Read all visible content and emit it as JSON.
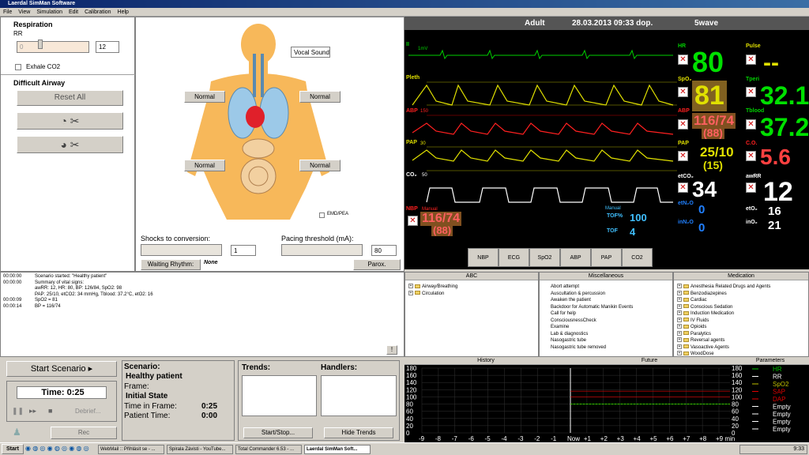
{
  "window": {
    "title": "Laerdal SimMan Software"
  },
  "menu": [
    "File",
    "View",
    "Simulation",
    "Edit",
    "Calibration",
    "Help"
  ],
  "respiration": {
    "title": "Respiration",
    "rr_label": "RR",
    "slider_min": "0",
    "rr_value": "12",
    "exhale_label": "Exhale CO2"
  },
  "airway": {
    "title": "Difficult Airway",
    "reset_label": "Reset All"
  },
  "body": {
    "vocal_label": "Vocal Sound",
    "status_labels": [
      "Normal",
      "Normal",
      "Normal",
      "Normal"
    ],
    "emd_label": "EMD/PEA"
  },
  "defib": {
    "shocks_label": "Shocks to conversion:",
    "shocks_value": "1",
    "pacing_label": "Pacing threshold (mA):",
    "pacing_value": "80",
    "waiting_label": "Waiting Rhythm:",
    "waiting_value": "None",
    "parox_label": "Parox."
  },
  "log": [
    {
      "time": "00:00:00",
      "text": "Scenario started: \"Healthy patient\""
    },
    {
      "time": "00:00:00",
      "text": "Summary of vital signs:"
    },
    {
      "time": "",
      "text": "awRR: 12, HR: 80, BP: 126/84, SpO2: 98"
    },
    {
      "time": "",
      "text": "PAP: 25/10, etCO2: 34 mmHg, Tblood: 37.2°C, etO2: 16"
    },
    {
      "time": "00:00:09",
      "text": "SpO2 = 81"
    },
    {
      "time": "00:00:14",
      "text": "BP = 116/74"
    }
  ],
  "log_button": "!",
  "scenario_ctrl": {
    "start_label": "Start Scenario",
    "time_label": "Time: 0:25",
    "debrief_label": "Debrief...",
    "rec_label": "Rec"
  },
  "scenario_info": {
    "scenario_label": "Scenario:",
    "scenario_name": "Healthy patient",
    "frame_label": "Frame:",
    "frame_name": "Initial State",
    "time_in_frame_label": "Time in Frame:",
    "time_in_frame": "0:25",
    "patient_time_label": "Patient Time:",
    "patient_time": "0:00"
  },
  "trends": {
    "trends_label": "Trends:",
    "handlers_label": "Handlers:",
    "start_stop_label": "Start/Stop...",
    "hide_label": "Hide Trends"
  },
  "monitor": {
    "patient_type": "Adult",
    "datetime": "28.03.2013 09:33 dop.",
    "mode": "5wave",
    "wave_labels": [
      "II",
      "Pleth",
      "ABP",
      "PAP",
      "CO₂"
    ],
    "wave_small": [
      "1mV",
      "",
      "150",
      "30",
      "50"
    ],
    "hr_label": "HR",
    "hr": "80",
    "spo2_label": "SpO₂",
    "spo2": "81",
    "abp_label": "ABP",
    "abp": "116/74",
    "abp_mean": "(88)",
    "pap_label": "PAP",
    "pap": "25/10",
    "pap_mean": "(15)",
    "etco2_label": "etCO₂",
    "etco2": "34",
    "etn2o_label": "etN₂O",
    "etn2o": "0",
    "inn2o_label": "inN₂O",
    "inn2o": "0",
    "pulse_label": "Pulse",
    "pulse": "--",
    "tperi_label": "Tperi",
    "tperi": "32.1",
    "tblood_label": "Tblood",
    "tblood": "37.2",
    "co_label": "C.O.",
    "co": "5.6",
    "awrr_label": "awRR",
    "awrr": "12",
    "eto2_label": "etO₂",
    "eto2": "16",
    "ino2_label": "inO₂",
    "ino2": "21",
    "nbp_label": "NBP",
    "nbp_sub": "Manual",
    "nbp": "116/74",
    "nbp_mean": "(88)",
    "tof_sub": "Manual",
    "tofp_label": "TOF%",
    "tofp": "100",
    "tof_label": "TOF",
    "tof": "4",
    "tabs": [
      "NBP",
      "ECG",
      "SpO2",
      "ABP",
      "PAP",
      "CO2"
    ]
  },
  "trees": {
    "abc_title": "ABC",
    "abc": [
      "Airway/Breathing",
      "Circulation"
    ],
    "misc_title": "Miscellaneous",
    "misc": [
      "Abort attempt",
      "Auscultation & percussion",
      "Awaken the patient",
      "Backdoor for Automatic Manikin Events",
      "Call for help",
      "ConsciousnessCheck",
      "Examine",
      "Lab & diagnostics",
      "Nasogastric tube",
      "Nasogastric tube removed"
    ],
    "med_title": "Medication",
    "med": [
      "Anesthesia Related Drugs and Agents",
      "Benzodiazepines",
      "Cardiac",
      "Conscious Sedation",
      "Induction Medication",
      "IV Fluids",
      "Opioids",
      "Paralytics",
      "Reversal agents",
      "Vasoactive Agents",
      "WoodDose"
    ]
  },
  "trend_chart": {
    "history_label": "History",
    "future_label": "Future",
    "params_label": "Parameters",
    "y_ticks": [
      "180",
      "160",
      "140",
      "120",
      "100",
      "80",
      "60",
      "40",
      "20",
      "0"
    ],
    "x_ticks": [
      "-9",
      "-8",
      "-7",
      "-6",
      "-5",
      "-4",
      "-3",
      "-2",
      "-1",
      "Now",
      "+1",
      "+2",
      "+3",
      "+4",
      "+5",
      "+6",
      "+7",
      "+8",
      "+9 min"
    ],
    "params": [
      {
        "name": "HR",
        "color": "#00c000"
      },
      {
        "name": "RR",
        "color": "#ffffff"
      },
      {
        "name": "SpO2",
        "color": "#c0c000"
      },
      {
        "name": "SAP",
        "color": "#e00000"
      },
      {
        "name": "DAP",
        "color": "#e00000"
      },
      {
        "name": "Empty",
        "color": "#ffffff"
      },
      {
        "name": "Empty",
        "color": "#ffffff"
      },
      {
        "name": "Empty",
        "color": "#ffffff"
      },
      {
        "name": "Empty",
        "color": "#ffffff"
      }
    ]
  },
  "taskbar": {
    "start_label": "Start",
    "tasks": [
      "WebMail :: Přihlásit se - ...",
      "Spirala Závisti - YouTube...",
      "Total Commander 6.53 - ...",
      "Laerdal SimMan Soft..."
    ],
    "clock": "9:33"
  }
}
